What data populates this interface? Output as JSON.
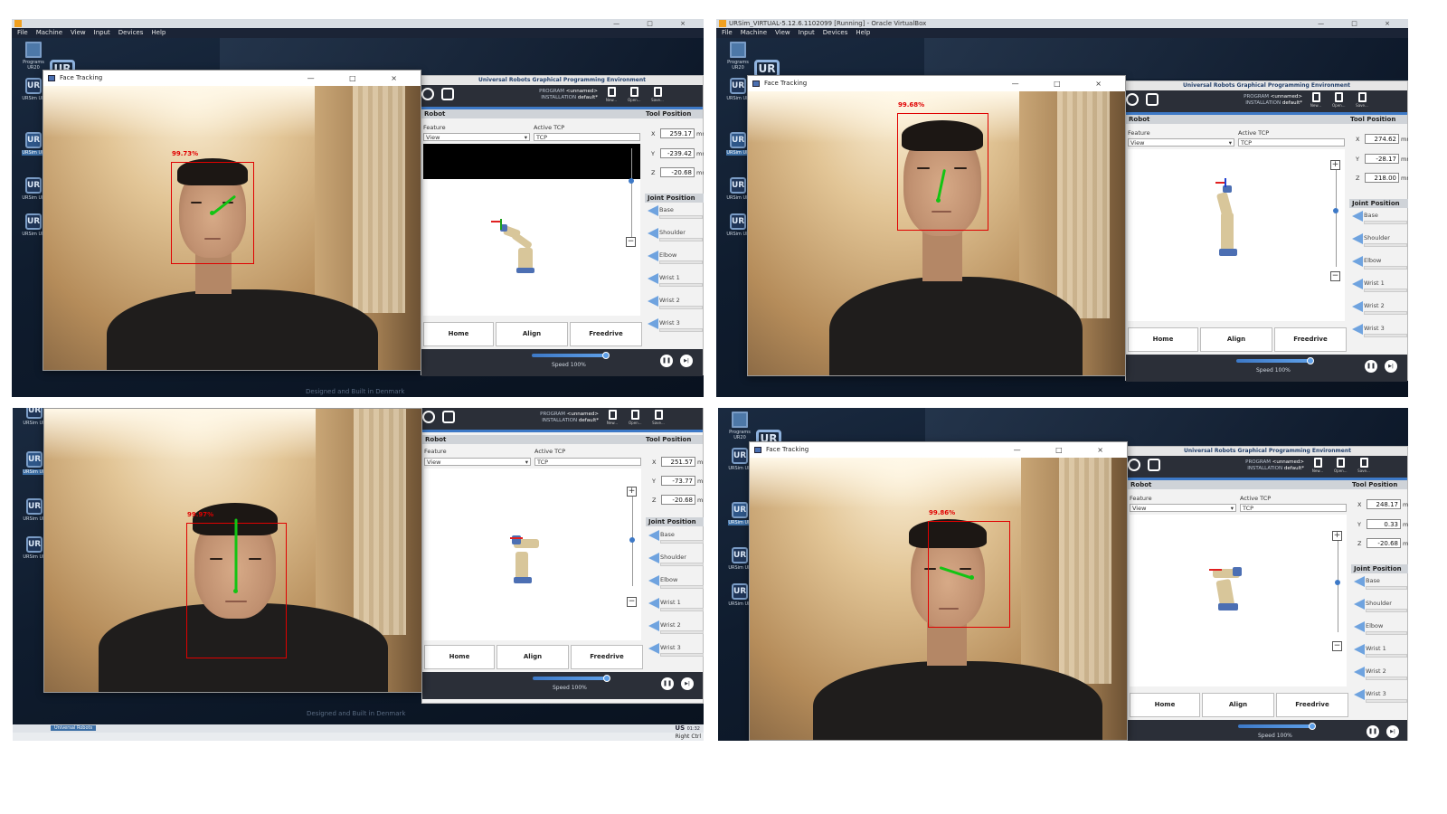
{
  "vbox": {
    "title_top_right": "URSim_VIRTUAL-5.12.6.1102099 [Running] - Oracle VirtualBox",
    "menu": [
      "File",
      "Machine",
      "View",
      "Input",
      "Devices",
      "Help"
    ]
  },
  "desktop": {
    "programs_label": "Programs UR20",
    "ursim_label": "URSim UR",
    "ur_logo": "UR",
    "designed_text": "Designed and Built in Denmark"
  },
  "face_tracking": {
    "window_title": "Face Tracking",
    "confidences": [
      "99.73%",
      "99.68%",
      "99.97%",
      "99.86%"
    ]
  },
  "ur": {
    "header": "Universal Robots Graphical Programming Environment",
    "program_label": "PROGRAM",
    "program_value": "<unnamed>",
    "installation_label": "INSTALLATION",
    "installation_value": "default*",
    "run_label": "Run",
    "log_label": "Log",
    "new_label": "New...",
    "open_label": "Open...",
    "save_label": "Save...",
    "robot_section": "Robot",
    "feature_label": "Feature",
    "feature_value": "View",
    "active_tcp_label": "Active TCP",
    "active_tcp_value": "TCP",
    "tool_position": "Tool Position",
    "joint_position": "Joint Position",
    "unit": "mm",
    "joints": [
      "Base",
      "Shoulder",
      "Elbow",
      "Wrist 1",
      "Wrist 2",
      "Wrist 3"
    ],
    "home": "Home",
    "align": "Align",
    "freedrive": "Freedrive",
    "speed": "Speed 100%",
    "zoom_in": "+",
    "zoom_out": "−"
  },
  "positions": [
    {
      "x": "259.17",
      "y": "-239.42",
      "z": "-20.68"
    },
    {
      "x": "274.62",
      "y": "-28.17",
      "z": "218.00"
    },
    {
      "x": "251.57",
      "y": "-73.77",
      "z": "-20.68"
    },
    {
      "x": "248.17",
      "y": "0.33",
      "z": "-20.68"
    }
  ],
  "taskbar": {
    "app": "Universal Robots",
    "lang": "US",
    "time": "01:32",
    "host_key": "Right Ctrl"
  },
  "icons": {
    "close": "×",
    "min": "—",
    "max": "□",
    "arrow": "›",
    "pause": "❚❚",
    "step": "▶|"
  }
}
